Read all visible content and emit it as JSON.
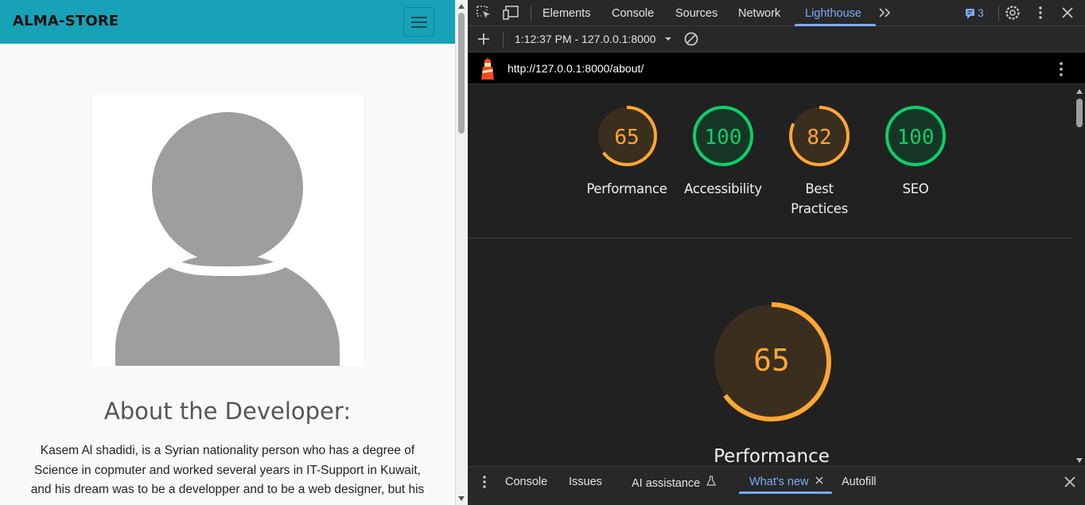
{
  "site": {
    "brand": "ALMA-STORE",
    "about_title": "About the Developer:",
    "about_text": "Kasem Al shadidi, is a Syrian nationality person who has a degree of Science in copmuter and worked several years in IT-Support in Kuwait, and his dream was to be a developper and to be a web designer, but his"
  },
  "devtools": {
    "tabs": [
      "Elements",
      "Console",
      "Sources",
      "Network",
      "Lighthouse"
    ],
    "active_tab": "Lighthouse",
    "issues_count": "3",
    "report_select": "1:12:37 PM - 127.0.0.1:8000",
    "report_url": "http://127.0.0.1:8000/about/",
    "scores": [
      {
        "name": "Performance",
        "label_line1": "Performance",
        "label_line2": "",
        "score": 65,
        "status": "average"
      },
      {
        "name": "Accessibility",
        "label_line1": "Accessibility",
        "label_line2": "",
        "score": 100,
        "status": "pass"
      },
      {
        "name": "Best Practices",
        "label_line1": "Best",
        "label_line2": "Practices",
        "score": 82,
        "status": "average"
      },
      {
        "name": "SEO",
        "label_line1": "SEO",
        "label_line2": "",
        "score": 100,
        "status": "pass"
      }
    ],
    "big_gauge": {
      "score": "65",
      "label": "Performance",
      "value": 65
    },
    "drawer_tabs": [
      "Console",
      "Issues",
      "AI assistance",
      "What's new",
      "Autofill"
    ],
    "drawer_active": "What's new"
  },
  "colors": {
    "navbar": "#17a2b8",
    "average": "#ffa733",
    "pass": "#0cce6b",
    "accent": "#7cacf8"
  },
  "icons": [
    "select-element-icon",
    "device-toolbar-icon",
    "more-tabs-icon",
    "issues-icon",
    "settings-icon",
    "kebab-menu-icon",
    "close-icon",
    "add-icon",
    "dropdown-icon",
    "clear-icon",
    "lighthouse-icon",
    "flask-icon"
  ]
}
